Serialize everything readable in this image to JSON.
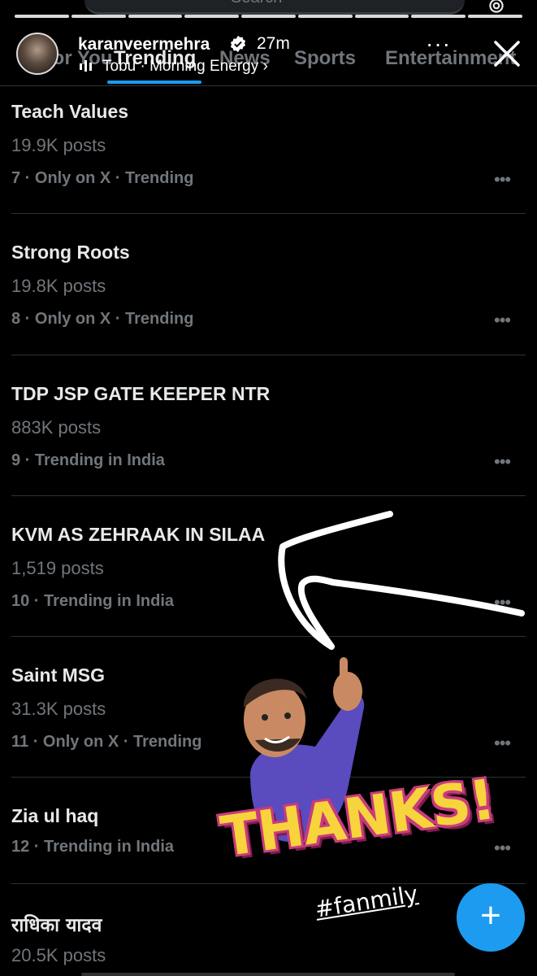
{
  "search": {
    "placeholder": "Search"
  },
  "tabs": [
    {
      "label": "For You"
    },
    {
      "label": "Trending"
    },
    {
      "label": "News"
    },
    {
      "label": "Sports"
    },
    {
      "label": "Entertainment"
    }
  ],
  "story": {
    "username": "karanveermehra",
    "time": "27m",
    "music": "Tobu · Morning Energy ›",
    "more": "···"
  },
  "trends": [
    {
      "title": "Teach Values",
      "posts": "19.9K posts",
      "meta": "7 · Only on X · Trending"
    },
    {
      "title": "Strong Roots",
      "posts": "19.8K posts",
      "meta": "8 · Only on X · Trending"
    },
    {
      "title": "TDP JSP GATE KEEPER NTR",
      "posts": "883K posts",
      "meta": "9 · Trending in India"
    },
    {
      "title": "KVM AS ZEHRAAK IN SILAA",
      "posts": "1,519 posts",
      "meta": "10 · Trending in India"
    },
    {
      "title": "Saint MSG",
      "posts": "31.3K posts",
      "meta": "11 · Only on X · Trending"
    },
    {
      "title": "Zia ul haq",
      "posts": "",
      "meta": "12 · Trending in India"
    },
    {
      "title": "राधिका यादव",
      "posts": "20.5K posts",
      "meta": ""
    }
  ],
  "dots": "•••",
  "stickers": {
    "thanks": "THANKS!",
    "hashtag": "#fanmily"
  },
  "fab": {
    "label": "+"
  },
  "colors": {
    "accent": "#1d9bf0",
    "muted": "#71767b",
    "text": "#e7e9ea",
    "thanks_fill": "#f7d43b",
    "thanks_outline": "#c93b7d"
  }
}
